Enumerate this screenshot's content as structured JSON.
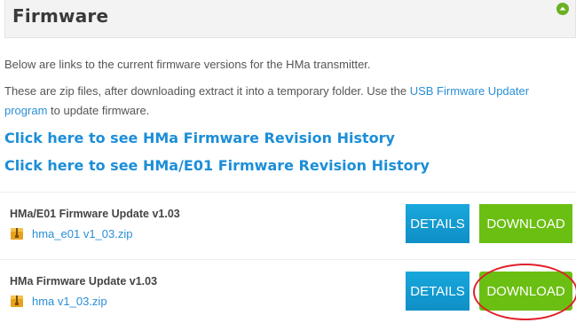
{
  "header": {
    "title": "Firmware",
    "collapse_icon": "chevron-up-circle-icon",
    "accent": "#6ab023"
  },
  "intro": {
    "line1": "Below are links to the current firmware versions for the HMa transmitter.",
    "line2_before": "These are zip files, after downloading extract it into a temporary folder. Use the ",
    "line2_link": "USB Firmware Updater program",
    "line2_after": " to update firmware."
  },
  "history_links": [
    "Click here to see HMa Firmware Revision History",
    "Click here to see HMa/E01 Firmware Revision History"
  ],
  "updates": [
    {
      "title": "HMa/E01 Firmware Update v1.03",
      "file": "hma_e01 v1_03.zip",
      "file_icon": "zip-archive-icon",
      "details_label": "DETAILS",
      "download_label": "DOWNLOAD"
    },
    {
      "title": "HMa Firmware Update v1.03",
      "file": "hma v1_03.zip",
      "file_icon": "zip-archive-icon",
      "details_label": "DETAILS",
      "download_label": "DOWNLOAD"
    }
  ],
  "colors": {
    "link": "#2a8fd6",
    "details_button": "#1296d0",
    "download_button": "#6abf12",
    "highlight": "#e0202a"
  }
}
